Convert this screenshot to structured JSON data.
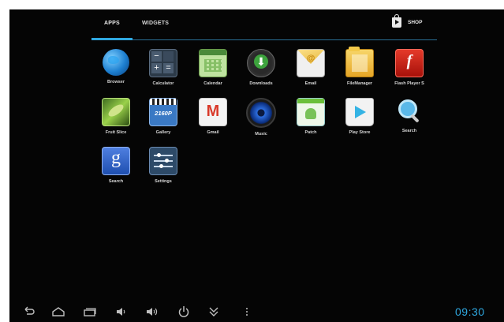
{
  "tabs": {
    "apps": "APPS",
    "widgets": "WIDGETS",
    "shop": "SHOP"
  },
  "apps": [
    {
      "label": "Browser",
      "icon": "browser-icon"
    },
    {
      "label": "Calculator",
      "icon": "calculator-icon"
    },
    {
      "label": "Calendar",
      "icon": "calendar-icon"
    },
    {
      "label": "Downloads",
      "icon": "downloads-icon"
    },
    {
      "label": "Email",
      "icon": "email-icon"
    },
    {
      "label": "FileManager",
      "icon": "file-manager-icon"
    },
    {
      "label": "Flash Player S",
      "icon": "flash-player-icon"
    },
    {
      "label": "Fruit Slice",
      "icon": "fruit-slice-icon"
    },
    {
      "label": "Gallery",
      "icon": "gallery-icon"
    },
    {
      "label": "Gmail",
      "icon": "gmail-icon"
    },
    {
      "label": "Music",
      "icon": "music-icon"
    },
    {
      "label": "Patch",
      "icon": "patch-icon"
    },
    {
      "label": "Play Store",
      "icon": "play-store-icon"
    },
    {
      "label": "Search",
      "icon": "search-icon"
    },
    {
      "label": "Search",
      "icon": "google-search-icon"
    },
    {
      "label": "Settings",
      "icon": "settings-icon"
    }
  ],
  "gallery_badge": "2160P",
  "status": {
    "time": "09:30"
  },
  "colors": {
    "accent": "#2fa8e0",
    "background": "#050505"
  }
}
